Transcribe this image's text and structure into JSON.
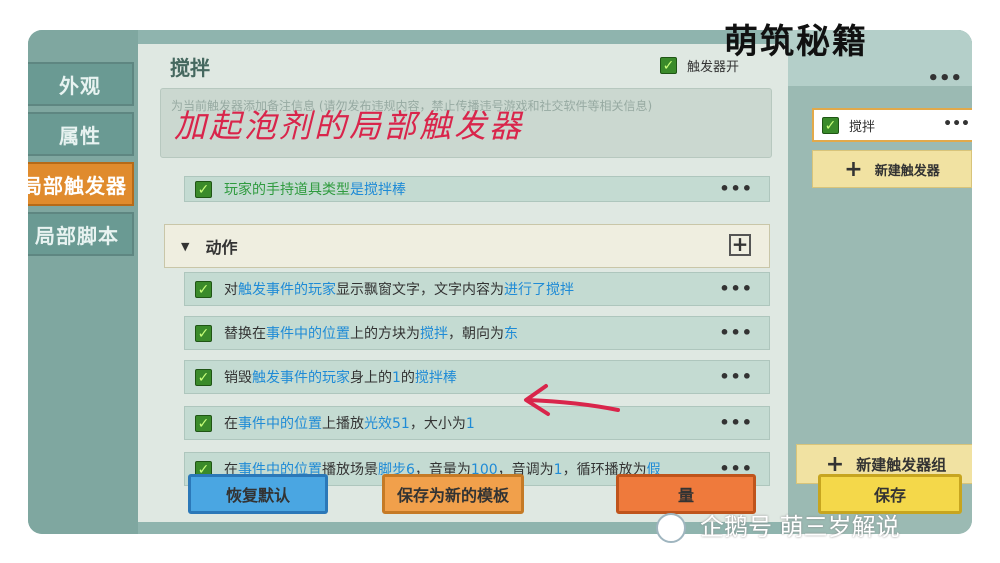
{
  "left_nav": {
    "items": [
      {
        "label": "外观"
      },
      {
        "label": "属性"
      },
      {
        "label": "局部触发器"
      },
      {
        "label": "局部脚本"
      }
    ]
  },
  "header": {
    "title": "搅拌",
    "trigger_switch_label": "触发器开"
  },
  "note": {
    "placeholder": "为当前触发器添加备注信息 (请勿发布违规内容，禁止传播违号游戏和社交软件等相关信息)",
    "overlay_text": "加起泡剂的局部触发器"
  },
  "condition_row": {
    "text_parts": [
      "玩家的手持道具类型",
      "是",
      "搅拌棒"
    ],
    "menu": "•••"
  },
  "actions_section": {
    "label": "动作",
    "add": "+"
  },
  "actions": [
    {
      "parts": [
        {
          "t": "对",
          "c": "n"
        },
        {
          "t": "触发事件的玩家",
          "c": "h"
        },
        {
          "t": "显示飘窗文字，文字内容为",
          "c": "n"
        },
        {
          "t": "进行了搅拌",
          "c": "h"
        }
      ]
    },
    {
      "parts": [
        {
          "t": "替换在",
          "c": "n"
        },
        {
          "t": "事件中的位置",
          "c": "h"
        },
        {
          "t": "上的方块为",
          "c": "n"
        },
        {
          "t": "搅拌",
          "c": "h"
        },
        {
          "t": "，朝向为",
          "c": "n"
        },
        {
          "t": "东",
          "c": "h"
        }
      ]
    },
    {
      "parts": [
        {
          "t": "销毁",
          "c": "n"
        },
        {
          "t": "触发事件的玩家",
          "c": "h"
        },
        {
          "t": "身上的",
          "c": "n"
        },
        {
          "t": "1",
          "c": "h"
        },
        {
          "t": "的",
          "c": "n"
        },
        {
          "t": "搅拌棒",
          "c": "h"
        }
      ]
    },
    {
      "parts": [
        {
          "t": "在",
          "c": "n"
        },
        {
          "t": "事件中的位置",
          "c": "h"
        },
        {
          "t": "上播放",
          "c": "n"
        },
        {
          "t": "光效51",
          "c": "h"
        },
        {
          "t": "，大小为",
          "c": "n"
        },
        {
          "t": "1",
          "c": "h"
        }
      ]
    },
    {
      "parts": [
        {
          "t": "在",
          "c": "n"
        },
        {
          "t": "事件中的位置",
          "c": "h"
        },
        {
          "t": "播放场景",
          "c": "n"
        },
        {
          "t": "脚步6",
          "c": "h"
        },
        {
          "t": "，音量为",
          "c": "n"
        },
        {
          "t": "100",
          "c": "h"
        },
        {
          "t": "，音调为",
          "c": "n"
        },
        {
          "t": "1",
          "c": "h"
        },
        {
          "t": "，循环播放为",
          "c": "n"
        },
        {
          "t": "假",
          "c": "h"
        }
      ]
    }
  ],
  "right_panel": {
    "logo": "萌筑秘籍",
    "menu": "•••",
    "trigger_item": "搅拌",
    "new_trigger": "新建触发器",
    "new_group": "新建触发器组"
  },
  "bottom_buttons": {
    "reset": "恢复默认",
    "save_template": "保存为新的模板",
    "cancel_partial": "量",
    "save_partial": "保存"
  },
  "watermark": "企鹅号 萌三岁解说",
  "colors": {
    "accent_orange": "#e08b2d",
    "highlight_blue": "#1f8bd6",
    "annotation_red": "#d9254b"
  }
}
